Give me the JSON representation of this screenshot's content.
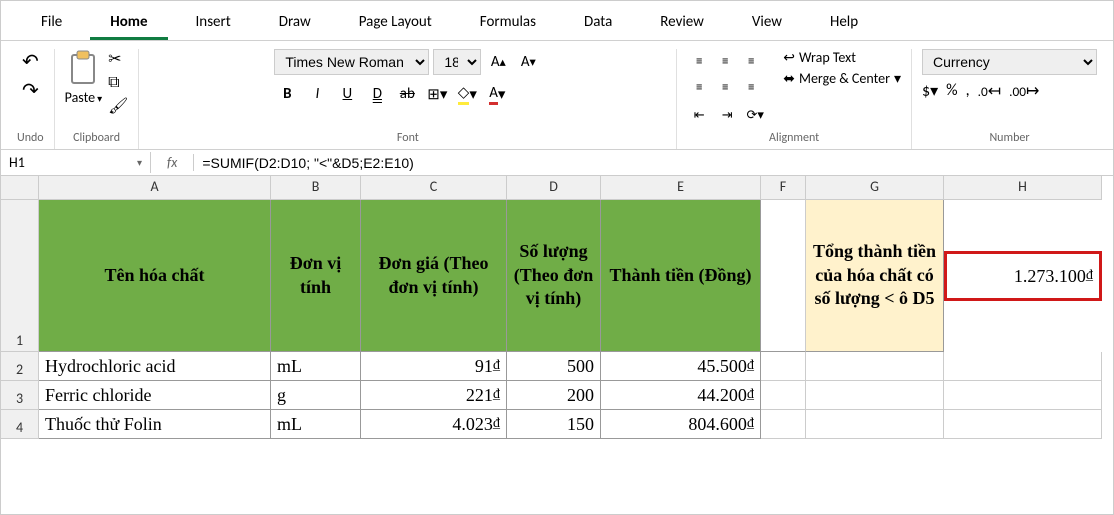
{
  "tabs": [
    "File",
    "Home",
    "Insert",
    "Draw",
    "Page Layout",
    "Formulas",
    "Data",
    "Review",
    "View",
    "Help"
  ],
  "activeTab": "Home",
  "groups": {
    "undo": "Undo",
    "clipboard": "Clipboard",
    "font": "Font",
    "alignment": "Alignment",
    "number": "Number"
  },
  "clipboard": {
    "paste": "Paste"
  },
  "font": {
    "name": "Times New Roman",
    "size": "18",
    "bold": "B",
    "italic": "I",
    "underline": "U",
    "double_underline": "D",
    "strike": "ab"
  },
  "alignment": {
    "wrap": "Wrap Text",
    "merge": "Merge & Center"
  },
  "number": {
    "format": "Currency"
  },
  "nameBox": "H1",
  "fx": "fx",
  "formula": "=SUMIF(D2:D10; \"<\"&D5;E2:E10)",
  "columns": [
    "A",
    "B",
    "C",
    "D",
    "E",
    "F",
    "G",
    "H"
  ],
  "rows": [
    "1",
    "2",
    "3",
    "4"
  ],
  "headers": {
    "A": "Tên hóa chất",
    "B": "Đơn vị tính",
    "C": "Đơn giá (Theo đơn vị tính)",
    "D": "Số lượng (Theo đơn vị tính)",
    "E": "Thành tiền (Đồng)",
    "G": "Tổng thành tiền của hóa chất có số lượng < ô D5",
    "H": "1.273.100"
  },
  "data": [
    {
      "A": "Hydrochloric acid",
      "B": "mL",
      "C": "91",
      "D": "500",
      "E": "45.500"
    },
    {
      "A": "Ferric chloride",
      "B": "g",
      "C": "221",
      "D": "200",
      "E": "44.200"
    },
    {
      "A": "Thuốc thử Folin",
      "B": "mL",
      "C": "4.023",
      "D": "150",
      "E": "804.600"
    }
  ]
}
